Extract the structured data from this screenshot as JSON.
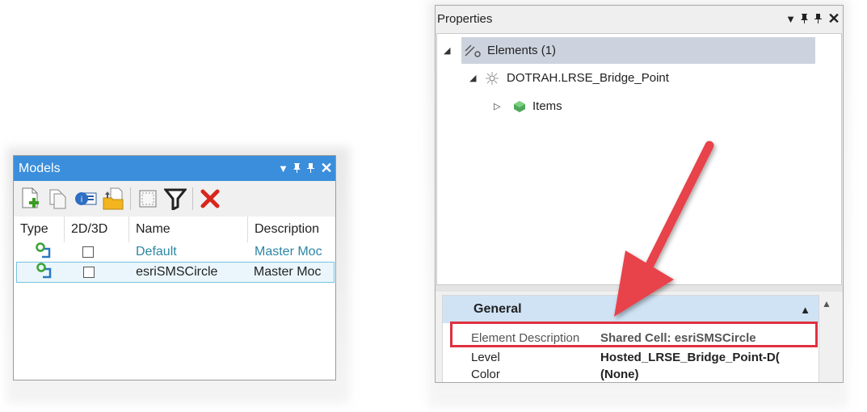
{
  "models_panel": {
    "title": "Models",
    "controls": {
      "dropdown": "▼",
      "pin1": "📌",
      "pin2": "📌",
      "close": "✕"
    },
    "toolbar_icons": [
      "new-model-icon",
      "copy-model-icon",
      "model-properties-icon",
      "import-model-icon",
      "select-icon",
      "filter-icon",
      "delete-icon"
    ],
    "columns": [
      "Type",
      "2D/3D",
      "Name",
      "Description"
    ],
    "rows": [
      {
        "name": "Default",
        "description": "Master Moc"
      },
      {
        "name": "esriSMSCircle",
        "description": "Master Moc"
      }
    ]
  },
  "properties_panel": {
    "title": "Properties",
    "controls": {
      "dropdown": "▼",
      "pin1": "📌",
      "pin2": "📌",
      "close": "✕"
    },
    "tree": {
      "root": {
        "expander": "◢",
        "label": "Elements (1)"
      },
      "child": {
        "expander": "◢",
        "label": "DOTRAH.LRSE_Bridge_Point"
      },
      "grandchild": {
        "expander": "▷",
        "label": "Items"
      }
    },
    "section": {
      "title": "General",
      "collapse": "▲",
      "scroll_up": "▲"
    },
    "rows": [
      {
        "label": "Element Description",
        "value": "Shared Cell: esriSMSCircle"
      },
      {
        "label": "Level",
        "value": "Hosted_LRSE_Bridge_Point-D("
      },
      {
        "label": "Color",
        "value": "(None)"
      }
    ]
  },
  "colors": {
    "title_bar": "#3b8edb",
    "highlight": "#e03040",
    "arrow": "#e8424c"
  }
}
